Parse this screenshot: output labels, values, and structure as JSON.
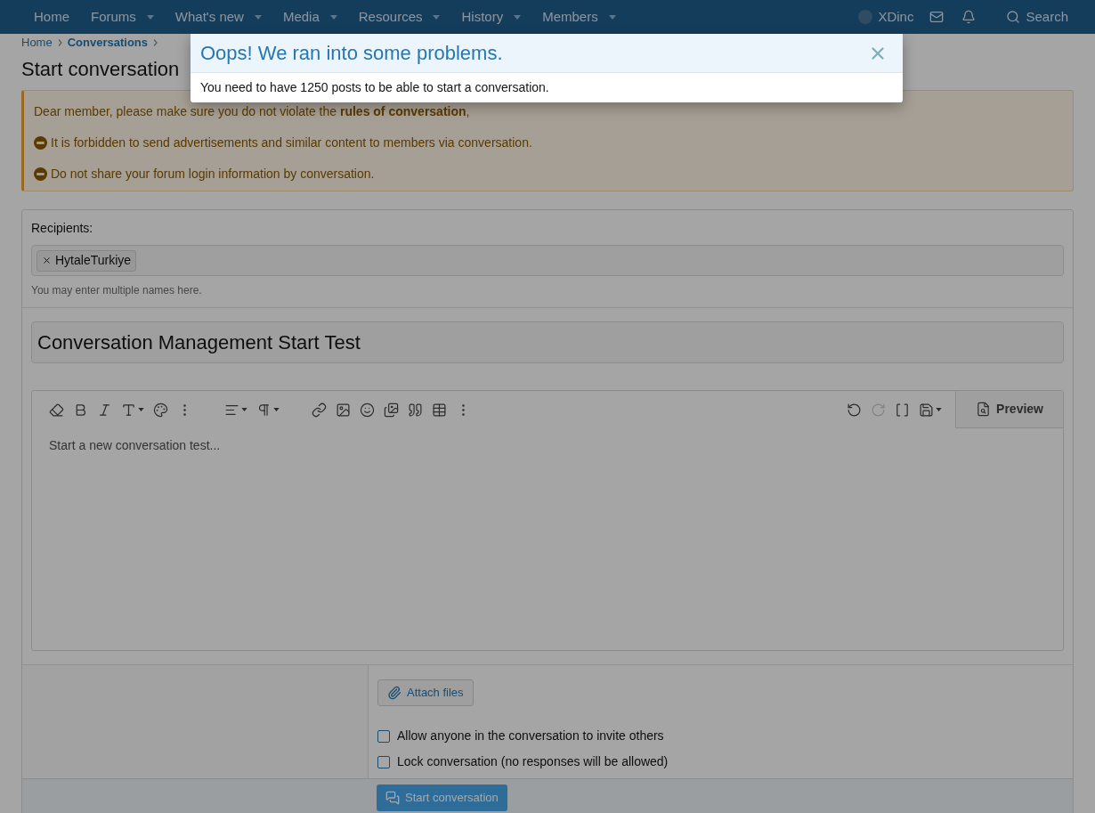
{
  "nav": {
    "items": [
      {
        "label": "Home",
        "has_menu": false
      },
      {
        "label": "Forums",
        "has_menu": true
      },
      {
        "label": "What's new",
        "has_menu": true
      },
      {
        "label": "Media",
        "has_menu": true
      },
      {
        "label": "Resources",
        "has_menu": true
      },
      {
        "label": "History",
        "has_menu": true
      },
      {
        "label": "Members",
        "has_menu": true
      }
    ],
    "user": "XDinc",
    "search": "Search"
  },
  "breadcrumbs": [
    {
      "label": "Home",
      "bold": false
    },
    {
      "label": "Conversations",
      "bold": true
    }
  ],
  "page_title": "Start conversation",
  "notice": {
    "intro": "Dear member, please make sure you do not violate the **rules of conversation**,",
    "rules": [
      "It is forbidden to send advertisements and similar content to members via conversation.",
      "Do not share your forum login information by conversation."
    ]
  },
  "recipients": {
    "label": "Recipients:",
    "tokens": [
      {
        "name": "HytaleTurkiye"
      }
    ],
    "hint": "You may enter multiple names here."
  },
  "title_field": {
    "value": "Conversation Management Start Test"
  },
  "editor": {
    "redo_disabled": true,
    "preview": "Preview",
    "placeholder": "Start a new conversation test..."
  },
  "attach": "Attach files",
  "options": [
    {
      "label": "Allow anyone in the conversation to invite others",
      "checked": false
    },
    {
      "label": "Lock conversation (no responses will be allowed)",
      "checked": false
    }
  ],
  "submit": "Start conversation",
  "modal": {
    "title": "Oops! We ran into some problems.",
    "message": "You need to have 1250 posts to be able to start a conversation."
  }
}
